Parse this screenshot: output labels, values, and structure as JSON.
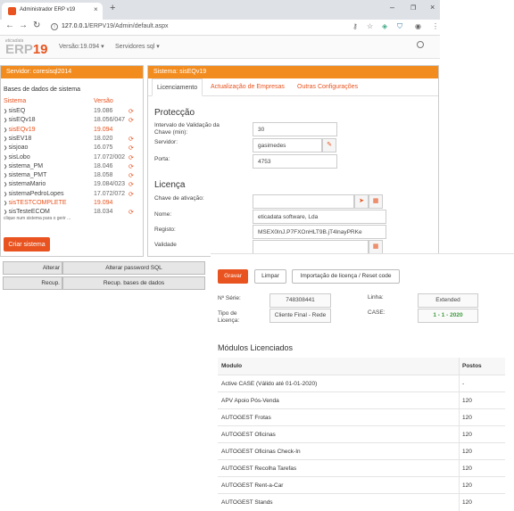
{
  "browser": {
    "tab_title": "Administrador ERP v19",
    "tab_close": "×",
    "new_tab": "+",
    "url_host": "127.0.0.1",
    "url_path": "/ERPV19/Admin/default.aspx",
    "minimize": "–",
    "maximize": "❐",
    "close": "×"
  },
  "header": {
    "logo_small": "eticadata",
    "logo_text": "ERP",
    "logo_num": "19",
    "version_menu": "Versão:19.094 ▾",
    "servers_menu": "Servidores sql ▾"
  },
  "left": {
    "server_title": "Servidor: coresisql2014",
    "list_title": "Bases de dados de sistema",
    "col_system": "Sistema",
    "col_version": "Versão",
    "systems": [
      {
        "name": "sisEQ",
        "version": "19.086",
        "refresh": true,
        "active": false
      },
      {
        "name": "sisEQv18",
        "version": "18.056/047",
        "refresh": true,
        "active": false
      },
      {
        "name": "sisEQv19",
        "version": "19.094",
        "refresh": false,
        "active": true
      },
      {
        "name": "sisEV18",
        "version": "18.020",
        "refresh": true,
        "active": false
      },
      {
        "name": "sisjoao",
        "version": "16.075",
        "refresh": true,
        "active": false
      },
      {
        "name": "sisLobo",
        "version": "17.072/002",
        "refresh": true,
        "active": false
      },
      {
        "name": "sistema_PM",
        "version": "18.046",
        "refresh": true,
        "active": false
      },
      {
        "name": "sistema_PMT",
        "version": "18.058",
        "refresh": true,
        "active": false
      },
      {
        "name": "sistemaMario",
        "version": "19.084/023",
        "refresh": true,
        "active": false
      },
      {
        "name": "sistemaPedroLopes",
        "version": "17.072/072",
        "refresh": true,
        "active": false
      },
      {
        "name": "sisTESTCOMPLETE",
        "version": "19.094",
        "refresh": false,
        "active": true
      },
      {
        "name": "sisTesteECOM",
        "version": "18.034",
        "refresh": true,
        "active": false
      }
    ],
    "hint": "clique num sistema para o gerir ...",
    "create_button": "Criar sistema"
  },
  "right": {
    "system_title": "Sistema: sisEQv19",
    "tabs": [
      "Licenciamento",
      "Actualização de Empresas",
      "Outras Configurações"
    ],
    "protection_title": "Protecção",
    "validation_label": "Intervalo de Validação da Chave (min):",
    "validation_value": "30",
    "server_label": "Servidor:",
    "server_value": "gasimedes",
    "port_label": "Porta:",
    "port_value": "4753",
    "license_title": "Licença",
    "activation_label": "Chave de ativação:",
    "activation_value": "",
    "name_label": "Nome:",
    "name_value": "eticadata software, Lda",
    "registry_label": "Registo:",
    "registry_value": "MSEX0lnJ.P7FXOnHLT9B.jT4lnayPRKe",
    "validity_label": "Validade",
    "validity_value": ""
  },
  "strip": {
    "btn_alterar": "Alterar",
    "btn_alterar_pwd": "Alterar password SQL",
    "btn_recup": "Recup.",
    "btn_recup_bd": "Recup. bases de dados"
  },
  "lower": {
    "btn_save": "Gravar",
    "btn_clear": "Limpar",
    "btn_import": "Importação de licença / Reset code",
    "serial_label": "Nº Série:",
    "serial_value": "748308441",
    "line_label": "Linha:",
    "line_value": "Extended",
    "license_type_label": "Tipo de Licença:",
    "license_type_value": "Cliente Final - Rede",
    "case_label": "CASE:",
    "case_value": "1 - 1 - 2020",
    "modules_title": "Módulos Licenciados",
    "col_module": "Modulo",
    "col_posts": "Postos",
    "modules": [
      {
        "name": "Active CASE (Válido até 01-01-2020)",
        "posts": "-"
      },
      {
        "name": "APV Apoio Pós-Venda",
        "posts": "120"
      },
      {
        "name": "AUTOGEST Frotas",
        "posts": "120"
      },
      {
        "name": "AUTOGEST Oficinas",
        "posts": "120"
      },
      {
        "name": "AUTOGEST Oficinas Check-In",
        "posts": "120"
      },
      {
        "name": "AUTOGEST Recolha Tarefas",
        "posts": "120"
      },
      {
        "name": "AUTOGEST Rent-a-Car",
        "posts": "120"
      },
      {
        "name": "AUTOGEST Stands",
        "posts": "120"
      }
    ]
  }
}
